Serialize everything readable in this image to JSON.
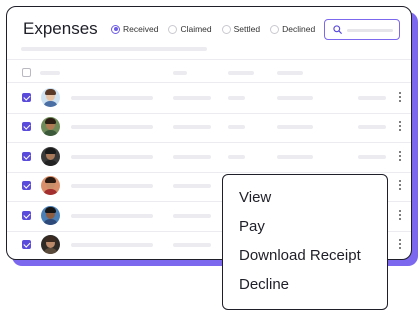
{
  "header": {
    "title": "Expenses"
  },
  "filters": [
    {
      "label": "Received",
      "selected": true
    },
    {
      "label": "Claimed",
      "selected": false
    },
    {
      "label": "Settled",
      "selected": false
    },
    {
      "label": "Declined",
      "selected": false
    }
  ],
  "search": {
    "icon": "search-icon"
  },
  "colors": {
    "accent": "#7b68ee",
    "checkbox": "#5a4bdb",
    "border": "#1f1f29"
  },
  "table": {
    "header_checked": false,
    "rows": [
      {
        "checked": true,
        "avatar": {
          "skin": "#e8c4a6",
          "hair": "#5a3a26",
          "shirt": "#4a6fa5",
          "bg": "#cfe3f3"
        }
      },
      {
        "checked": true,
        "avatar": {
          "skin": "#b07a55",
          "hair": "#2b1d14",
          "shirt": "#3c5a3a",
          "bg": "#6d8a58"
        }
      },
      {
        "checked": true,
        "avatar": {
          "skin": "#a9795a",
          "hair": "#1a1a1a",
          "shirt": "#222222",
          "bg": "#3a3a3a"
        }
      },
      {
        "checked": true,
        "avatar": {
          "skin": "#c8906a",
          "hair": "#2a1a12",
          "shirt": "#a3302f",
          "bg": "#d98f6a"
        }
      },
      {
        "checked": true,
        "avatar": {
          "skin": "#8e5c3f",
          "hair": "#151515",
          "shirt": "#2e4a7a",
          "bg": "#4a7fb5"
        }
      },
      {
        "checked": true,
        "avatar": {
          "skin": "#b9896a",
          "hair": "#3a2a20",
          "shirt": "#5a4a3a",
          "bg": "#2e2a26"
        }
      }
    ]
  },
  "menu": {
    "items": [
      "View",
      "Pay",
      "Download Receipt",
      "Decline"
    ]
  }
}
